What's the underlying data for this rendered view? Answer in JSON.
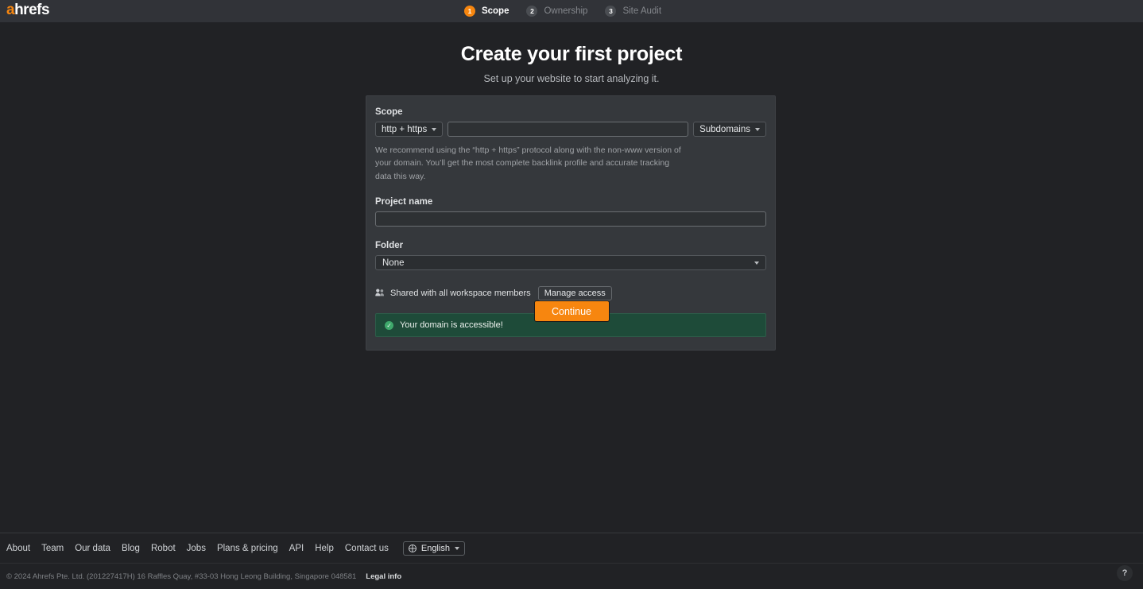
{
  "brand": {
    "logo_accent_letter": "a",
    "logo_rest": "hrefs",
    "accent_color": "#f7860f"
  },
  "header": {
    "steps": [
      {
        "number": "1",
        "label": "Scope",
        "active": true
      },
      {
        "number": "2",
        "label": "Ownership",
        "active": false
      },
      {
        "number": "3",
        "label": "Site Audit",
        "active": false
      }
    ]
  },
  "main": {
    "title": "Create your first project",
    "subtitle": "Set up your website to start analyzing it.",
    "scope": {
      "label": "Scope",
      "protocol_value": "http + https",
      "url_value": "",
      "url_placeholder": "",
      "subdomains_value": "Subdomains",
      "hint": "We recommend using the “http + https” protocol along with the non-www version of your domain. You’ll get the most complete backlink profile and accurate tracking data this way."
    },
    "project_name": {
      "label": "Project name",
      "value": "",
      "placeholder": ""
    },
    "folder": {
      "label": "Folder",
      "value": "None"
    },
    "sharing": {
      "icon": "users-icon",
      "text": "Shared with all workspace members",
      "manage_label": "Manage access"
    },
    "alert": {
      "icon": "check-circle-icon",
      "text": "Your domain is accessible!",
      "background_color": "#1e4b39",
      "icon_color": "#3fa96c"
    },
    "continue_label": "Continue"
  },
  "footer": {
    "links": [
      "About",
      "Team",
      "Our data",
      "Blog",
      "Robot",
      "Jobs",
      "Plans & pricing",
      "API",
      "Help",
      "Contact us"
    ],
    "language": "English",
    "copyright": "© 2024 Ahrefs Pte. Ltd. (201227417H) 16 Raffles Quay, #33-03 Hong Leong Building, Singapore 048581",
    "legal_label": "Legal info",
    "help_label": "?"
  }
}
